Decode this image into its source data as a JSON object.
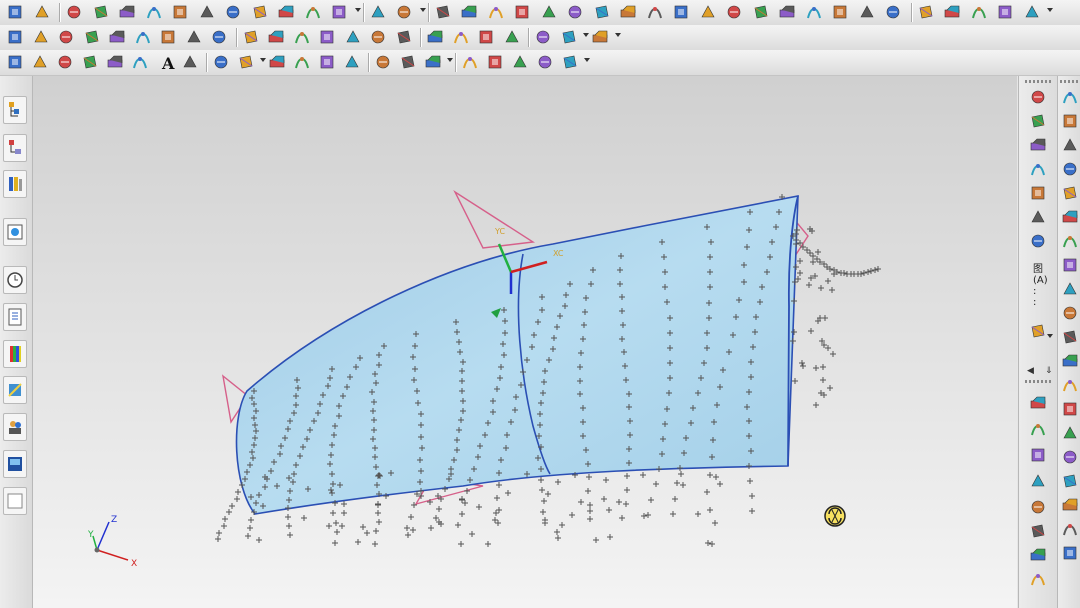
{
  "toolbars": {
    "text_tool_glyph": "A"
  },
  "right_palette": {
    "label_chars": "图\n(A)\n:\n:"
  },
  "triad": {
    "x_label": "X",
    "y_label": "Y",
    "z_label": "Z"
  },
  "wcs": {
    "xc_label": "XC",
    "yc_label": "YC"
  },
  "colors": {
    "surface_fill": "#a9d2ea",
    "surface_edge": "#2b4fb4",
    "points": "#555555",
    "triad_x": "#d02020",
    "triad_y": "#20b040",
    "triad_z": "#2030d0",
    "viewport_bg_top": "#cfcfcf",
    "viewport_bg_bottom": "#f2f2f2",
    "plane_marker": "#d6608a"
  },
  "icons": {
    "toolbar_row1": [
      "sketch-icon",
      "datum-icon",
      "extrude-icon",
      "revolve-icon",
      "sweep-icon",
      "feature-icon",
      "block-icon",
      "cylinder-icon",
      "cone-icon",
      "sphere-icon",
      "hole-icon",
      "boss-icon",
      "pocket-icon",
      "pad-icon",
      "slot-icon",
      "groove-icon",
      "edge-blend-icon",
      "chamfer-icon",
      "shell-icon",
      "thicken-icon",
      "draft-icon",
      "trim-body-icon",
      "split-body-icon",
      "unite-icon",
      "subtract-icon",
      "intersect-icon",
      "pattern-icon",
      "mirror-icon",
      "offset-face-icon",
      "move-face-icon",
      "replace-face-icon",
      "delete-face-icon",
      "scale-icon",
      "wrap-icon",
      "emboss-icon",
      "tube-icon",
      "layer-icon",
      "view-icon"
    ],
    "toolbar_row2": [
      "point-icon",
      "plane-icon",
      "surface-icon",
      "through-curves-icon",
      "mesh-icon",
      "sweep-surface-icon",
      "ruled-icon",
      "studio-surface-icon",
      "n-sided-icon",
      "bounded-plane-icon",
      "trim-sheet-icon",
      "extend-icon",
      "offset-surface-icon",
      "sew-icon",
      "patch-icon",
      "fillet-icon",
      "face-blend-icon",
      "styled-blend-icon",
      "x-form-icon",
      "i-form-icon",
      "match-edge-icon",
      "global-shape-icon",
      "analysis-icon"
    ],
    "toolbar_row3": [
      "line-icon",
      "arc-icon",
      "circle-icon",
      "spline-icon",
      "helix-icon",
      "curve-icon",
      "text-icon",
      "point-set-icon",
      "offset-curve-icon",
      "project-curve-icon",
      "intersect-curve-icon",
      "bridge-curve-icon",
      "extract-curve-icon",
      "trim-curve-icon",
      "divide-curve-icon",
      "edit-curve-icon",
      "join-curve-icon",
      "smooth-icon",
      "curvature-icon",
      "deviation-icon",
      "section-icon",
      "combs-icon"
    ]
  }
}
